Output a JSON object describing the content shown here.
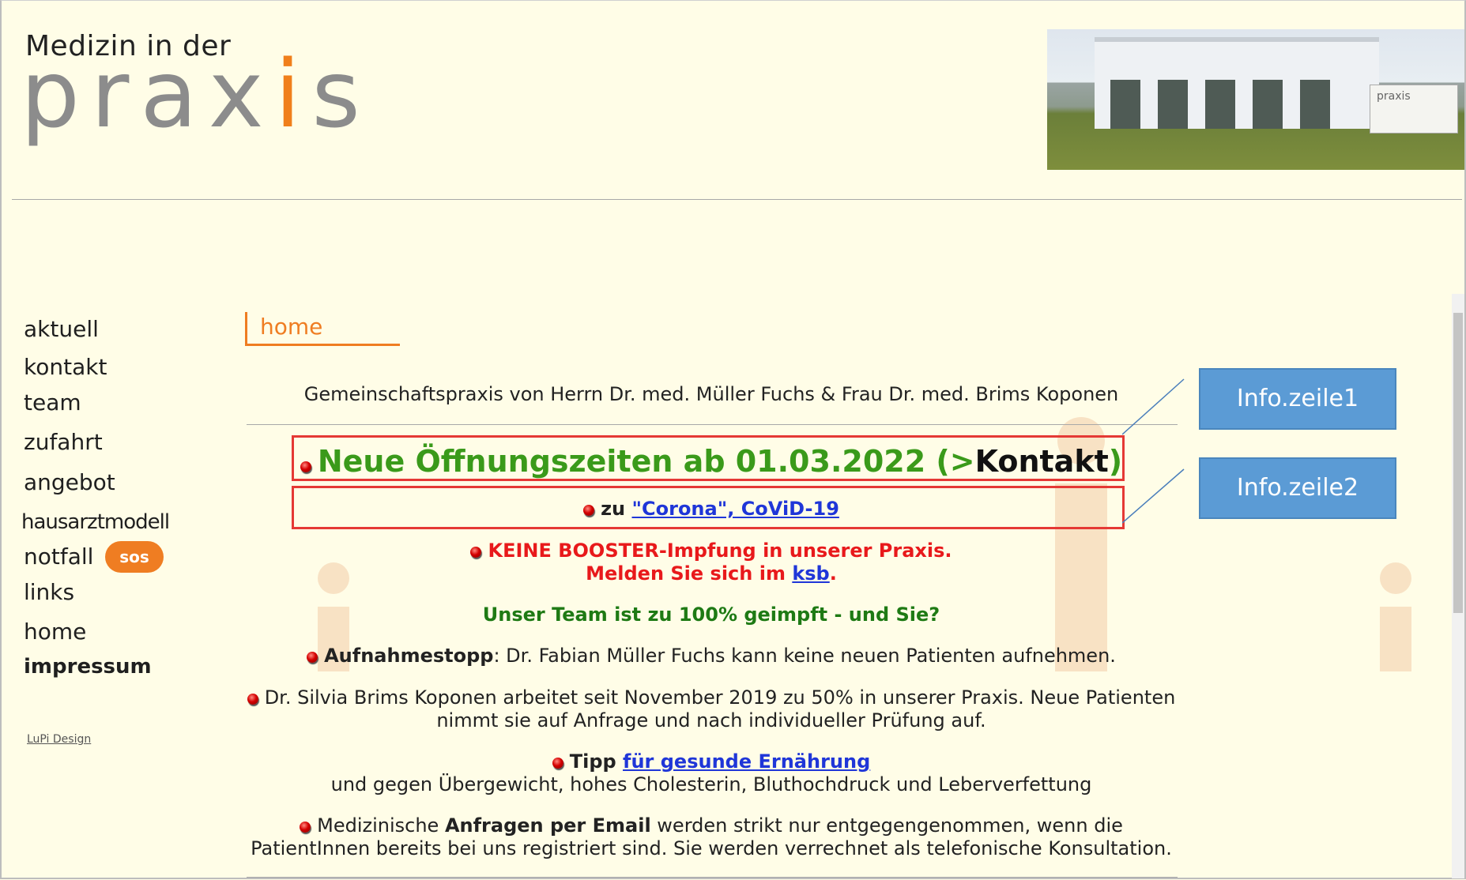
{
  "header": {
    "logo_top": "Medizin in der",
    "logo_main_start": "prax",
    "logo_i": "i",
    "logo_main_end": "s",
    "photo_sign": "praxis"
  },
  "nav": {
    "items": [
      "aktuell",
      "kontakt",
      "team",
      "zufahrt",
      "angebot",
      "hausarztmodell",
      "notfall",
      "links",
      "home",
      "impressum"
    ],
    "sos_badge": "sos",
    "lupi": "LuPi Design"
  },
  "main": {
    "tab": "home",
    "subtitle": "Gemeinschaftspraxis von Herrn Dr. med. Müller Fuchs & Frau Dr. med. Brims Koponen",
    "line1_green": "Neue Öffnungszeiten ab 01.03.2022 (>",
    "line1_black": "Kontakt",
    "line1_close": ")",
    "line2_prefix": "zu ",
    "line2_link": "\"Corona\", CoViD-19",
    "booster_1": "KEINE BOOSTER-Impfung in unserer Praxis.",
    "booster_2a": "Melden Sie sich im ",
    "booster_2_link": "ksb",
    "booster_2b": ".",
    "team_line": "Unser Team ist zu 100% geimpft - und Sie?",
    "stop_bold": "Aufnahmestopp",
    "stop_rest": ": Dr. Fabian Müller Fuchs kann keine neuen Patienten aufnehmen.",
    "silvia_1": "Dr. Silvia Brims Koponen arbeitet seit November 2019 zu 50% in unserer Praxis. Neue Patienten",
    "silvia_2": "nimmt sie auf Anfrage und nach individueller Prüfung auf.",
    "tipp_bold": "Tipp ",
    "tipp_link": "für gesunde Ernährung",
    "tipp_2": "und gegen Übergewicht, hohes Cholesterin, Bluthochdruck und Leberverfettung",
    "email_a": "Medizinische ",
    "email_bold": "Anfragen per Email",
    "email_b": " werden strikt nur entgegengenommen, wenn die",
    "email_2": "PatientInnen bereits bei uns registriert sind. Sie werden verrechnet als telefonische Konsultation."
  },
  "callouts": [
    "Info.zeile1",
    "Info.zeile2"
  ],
  "colors": {
    "accent": "#ef7d22",
    "green": "#3a9a1a",
    "darkgreen": "#1e7a14",
    "red": "#e8191b",
    "link": "#1f36d8",
    "callout": "#5b9bd5",
    "background": "#fffde7"
  }
}
